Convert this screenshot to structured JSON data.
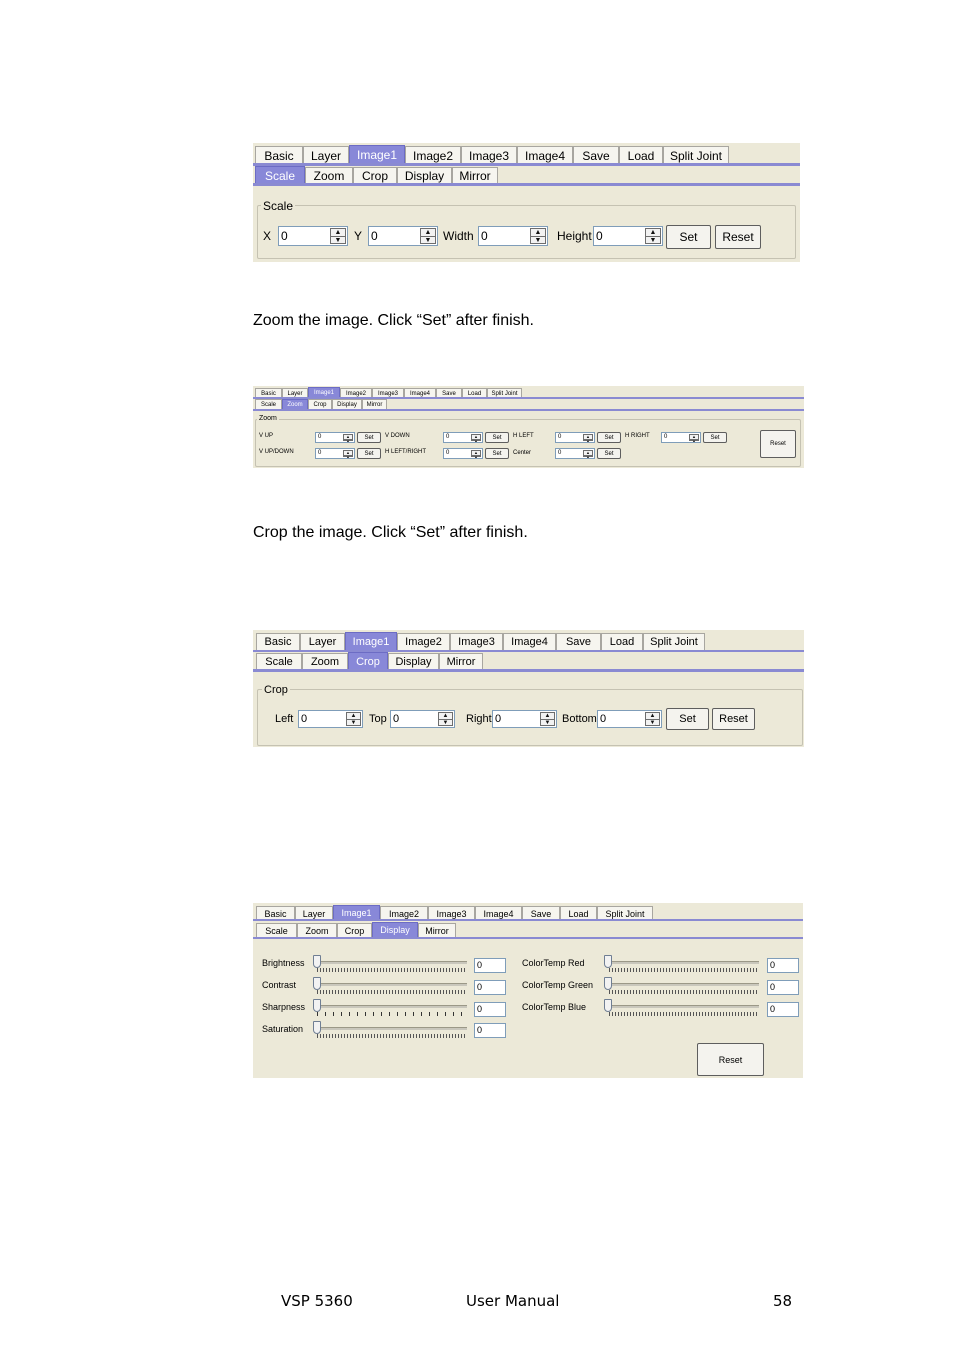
{
  "main_tabs": [
    "Basic",
    "Layer",
    "Image1",
    "Image2",
    "Image3",
    "Image4",
    "Save",
    "Load",
    "Split Joint"
  ],
  "sub_tabs": [
    "Scale",
    "Zoom",
    "Crop",
    "Display",
    "Mirror"
  ],
  "scale_panel": {
    "group_title": "Scale",
    "x_label": "X",
    "x_value": "0",
    "y_label": "Y",
    "y_value": "0",
    "width_label": "Width",
    "width_value": "0",
    "height_label": "Height",
    "height_value": "0",
    "set_label": "Set",
    "reset_label": "Reset"
  },
  "zoom_instruction": "Zoom the image. Click “Set” after finish.",
  "zoom_panel": {
    "group_title": "Zoom",
    "v_up_label": "V UP",
    "v_up_value": "0",
    "v_down_label": "V DOWN",
    "v_down_value": "0",
    "h_left_label": "H LEFT",
    "h_left_value": "0",
    "h_right_label": "H RIGHT",
    "h_right_value": "0",
    "v_updown_label": "V UP/DOWN",
    "v_updown_value": "0",
    "h_leftright_label": "H LEFT/RIGHT",
    "h_leftright_value": "0",
    "center_label": "Center",
    "center_value": "0",
    "set_label": "Set",
    "reset_label": "Reset"
  },
  "crop_instruction": "Crop the image. Click “Set” after finish.",
  "crop_panel": {
    "group_title": "Crop",
    "left_label": "Left",
    "left_value": "0",
    "top_label": "Top",
    "top_value": "0",
    "right_label": "Right",
    "right_value": "0",
    "bottom_label": "Bottom",
    "bottom_value": "0",
    "set_label": "Set",
    "reset_label": "Reset"
  },
  "display_panel": {
    "brightness_label": "Brightness",
    "brightness_value": "0",
    "contrast_label": "Contrast",
    "contrast_value": "0",
    "sharpness_label": "Sharpness",
    "sharpness_value": "0",
    "saturation_label": "Saturation",
    "saturation_value": "0",
    "colortemp_red_label": "ColorTemp Red",
    "colortemp_red_value": "0",
    "colortemp_green_label": "ColorTemp Green",
    "colortemp_green_value": "0",
    "colortemp_blue_label": "ColorTemp Blue",
    "colortemp_blue_value": "0",
    "reset_label": "Reset"
  },
  "footer": {
    "product": "VSP 5360",
    "doc_title": "User Manual",
    "page_number": "58"
  },
  "colors": {
    "panel_bg": "#ece9d8",
    "active_tab": "#8888d8",
    "tab_rule": "#8a8ad2"
  }
}
